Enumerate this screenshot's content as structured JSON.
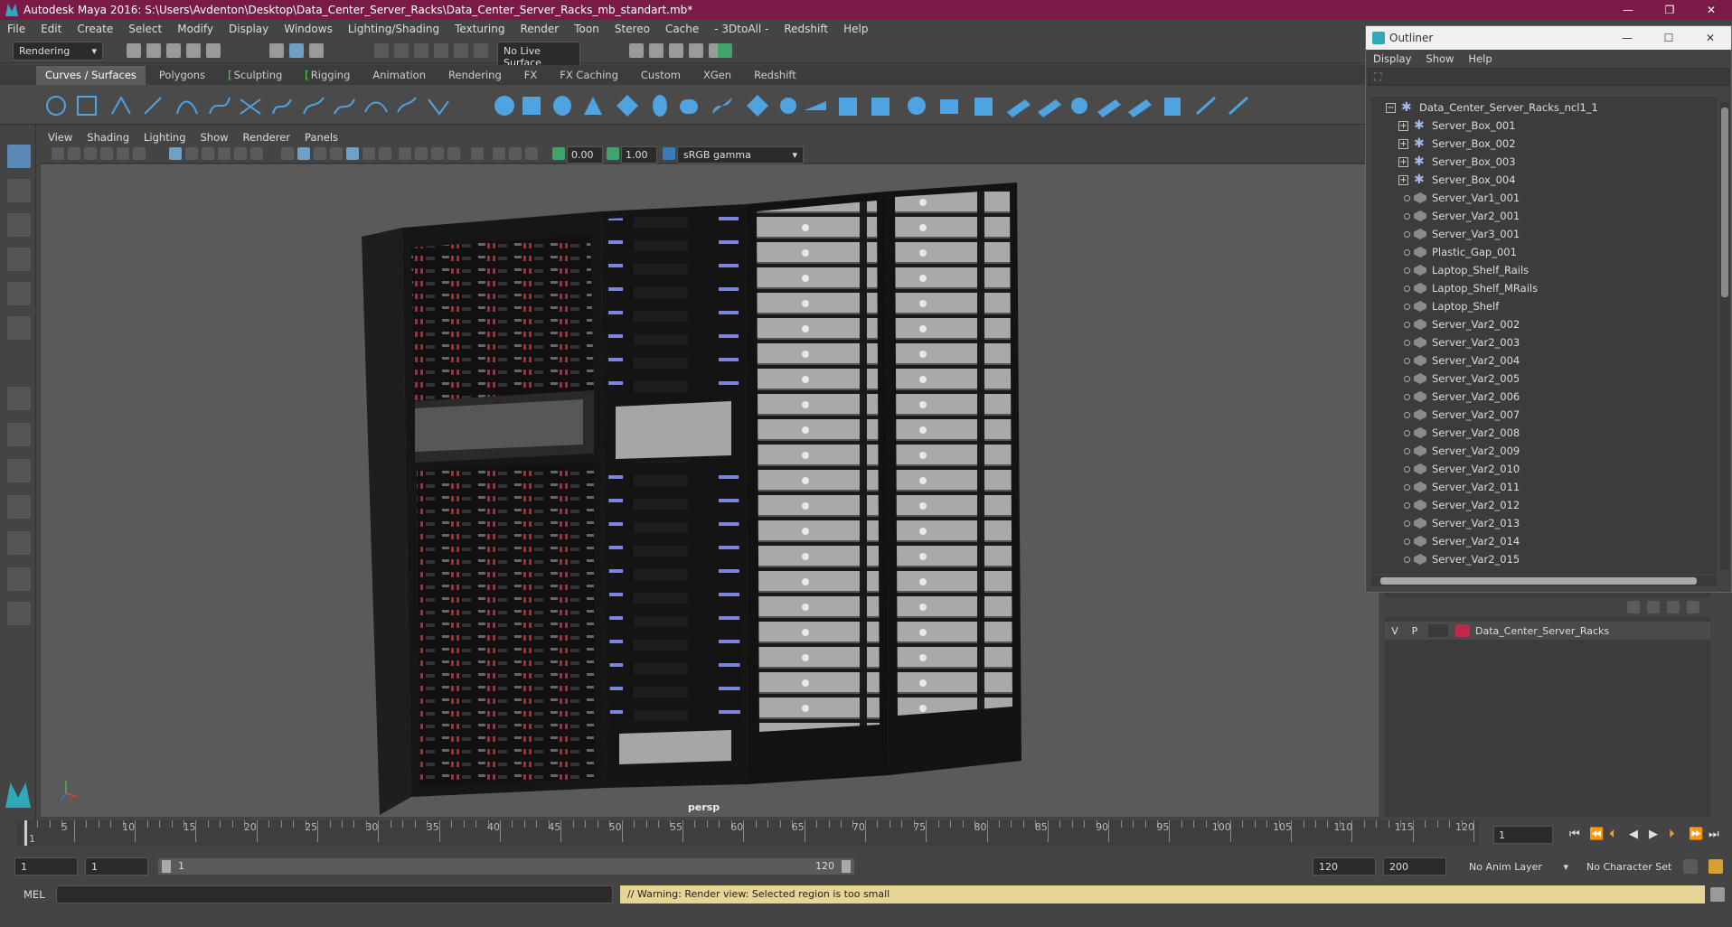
{
  "app": {
    "window_title": "Autodesk Maya 2016: S:\\Users\\Avdenton\\Desktop\\Data_Center_Server_Racks\\Data_Center_Server_Racks_mb_standart.mb*",
    "window_buttons": [
      "—",
      "❐",
      "✕"
    ]
  },
  "menubar": [
    "File",
    "Edit",
    "Create",
    "Select",
    "Modify",
    "Display",
    "Windows",
    "Lighting/Shading",
    "Texturing",
    "Render",
    "Toon",
    "Stereo",
    "Cache",
    "- 3DtoAll -",
    "Redshift",
    "Help"
  ],
  "statusline": {
    "menuset": "Rendering",
    "live_surface": "No Live Surface"
  },
  "shelf_tabs": [
    {
      "label": "Curves / Surfaces",
      "active": true
    },
    {
      "label": "Polygons"
    },
    {
      "label": "Sculpting",
      "bracket": true
    },
    {
      "label": "Rigging",
      "bracket": true
    },
    {
      "label": "Animation"
    },
    {
      "label": "Rendering"
    },
    {
      "label": "FX"
    },
    {
      "label": "FX Caching"
    },
    {
      "label": "Custom"
    },
    {
      "label": "XGen"
    },
    {
      "label": "Redshift"
    }
  ],
  "panel": {
    "menu": [
      "View",
      "Shading",
      "Lighting",
      "Show",
      "Renderer",
      "Panels"
    ],
    "exposure": "0.00",
    "gamma": "1.00",
    "colorspace": "sRGB gamma",
    "camera": "persp"
  },
  "outliner": {
    "title": "Outliner",
    "menu": [
      "Display",
      "Show",
      "Help"
    ],
    "root": "Data_Center_Server_Racks_ncl1_1",
    "items": [
      {
        "label": "Server_Box_001",
        "type": "group"
      },
      {
        "label": "Server_Box_002",
        "type": "group"
      },
      {
        "label": "Server_Box_003",
        "type": "group"
      },
      {
        "label": "Server_Box_004",
        "type": "group"
      },
      {
        "label": "Server_Var1_001",
        "type": "mesh"
      },
      {
        "label": "Server_Var2_001",
        "type": "mesh"
      },
      {
        "label": "Server_Var3_001",
        "type": "mesh"
      },
      {
        "label": "Plastic_Gap_001",
        "type": "mesh"
      },
      {
        "label": "Laptop_Shelf_Rails",
        "type": "mesh"
      },
      {
        "label": "Laptop_Shelf_MRails",
        "type": "mesh"
      },
      {
        "label": "Laptop_Shelf",
        "type": "mesh"
      },
      {
        "label": "Server_Var2_002",
        "type": "mesh"
      },
      {
        "label": "Server_Var2_003",
        "type": "mesh"
      },
      {
        "label": "Server_Var2_004",
        "type": "mesh"
      },
      {
        "label": "Server_Var2_005",
        "type": "mesh"
      },
      {
        "label": "Server_Var2_006",
        "type": "mesh"
      },
      {
        "label": "Server_Var2_007",
        "type": "mesh"
      },
      {
        "label": "Server_Var2_008",
        "type": "mesh"
      },
      {
        "label": "Server_Var2_009",
        "type": "mesh"
      },
      {
        "label": "Server_Var2_010",
        "type": "mesh"
      },
      {
        "label": "Server_Var2_011",
        "type": "mesh"
      },
      {
        "label": "Server_Var2_012",
        "type": "mesh"
      },
      {
        "label": "Server_Var2_013",
        "type": "mesh"
      },
      {
        "label": "Server_Var2_014",
        "type": "mesh"
      },
      {
        "label": "Server_Var2_015",
        "type": "mesh"
      }
    ]
  },
  "layer": {
    "v": "V",
    "p": "P",
    "name": "Data_Center_Server_Racks",
    "color": "#c1274a"
  },
  "timeline": {
    "ticks": [
      "5",
      "10",
      "15",
      "20",
      "25",
      "30",
      "35",
      "40",
      "45",
      "50",
      "55",
      "60",
      "65",
      "70",
      "75",
      "80",
      "85",
      "90",
      "95",
      "100",
      "105",
      "110",
      "115",
      "120"
    ],
    "start_tick": "1",
    "current_frame": "1"
  },
  "range": {
    "start": "1",
    "playback_start": "1",
    "slider_start": "1",
    "slider_end": "120",
    "playback_end": "120",
    "end": "200",
    "anim_layer": "No Anim Layer",
    "char_set": "No Character Set"
  },
  "command": {
    "lang": "MEL",
    "warning": "// Warning: Render view: Selected region is too small"
  }
}
